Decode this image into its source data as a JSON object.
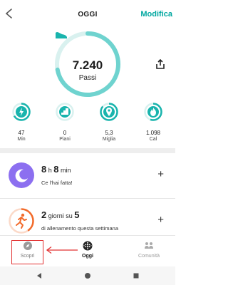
{
  "header": {
    "title": "OGGI",
    "edit_label": "Modifica"
  },
  "steps": {
    "value": "7.240",
    "label": "Passi",
    "progress": 0.72
  },
  "stats": [
    {
      "value": "47",
      "label": "Min",
      "icon": "bolt-icon"
    },
    {
      "value": "0",
      "label": "Piani",
      "icon": "stairs-icon"
    },
    {
      "value": "5,3",
      "label": "Miglia",
      "icon": "location-pin-icon"
    },
    {
      "value": "1.098",
      "label": "Cal",
      "icon": "flame-icon"
    }
  ],
  "sleep": {
    "hours": "8",
    "h_unit": "h",
    "minutes": "8",
    "m_unit": "min",
    "sub": "Ce l'hai fatta!"
  },
  "exercise": {
    "done": "2",
    "middle": "giorni su",
    "goal": "5",
    "sub": "di allenamento questa settimana"
  },
  "tabs": {
    "discover": "Scopri",
    "today": "Oggi",
    "community": "Comunità"
  },
  "colors": {
    "accent": "#00a7a0",
    "ring": "#6fd3cf",
    "sleep": "#8c6ff0",
    "exercise": "#f26a2a",
    "highlight": "#e23030"
  }
}
